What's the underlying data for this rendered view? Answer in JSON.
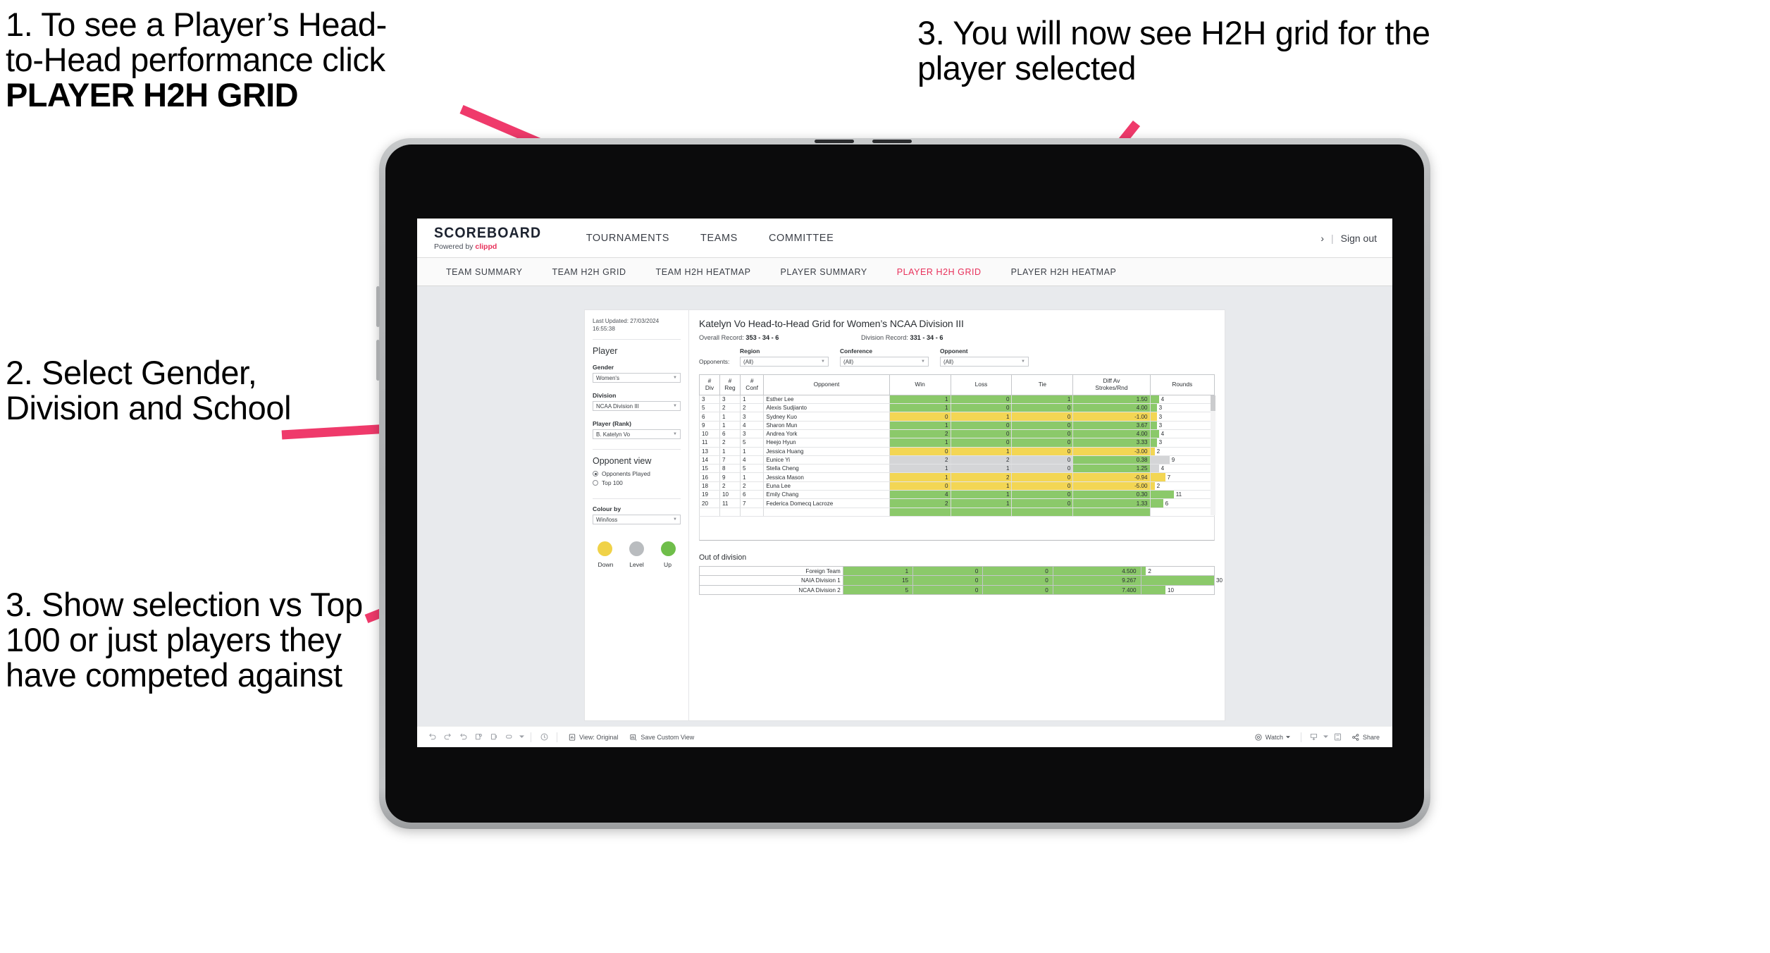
{
  "annotations": {
    "a1_line1": "1. To see a Player’s Head-",
    "a1_line2": "to-Head performance click",
    "a1_bold": "PLAYER H2H GRID",
    "a2": "2. Select Gender, Division and School",
    "a3": "3. Show selection vs Top 100 or just players they have competed against",
    "a4": "3. You will now see H2H grid for the player selected",
    "arrow_color": "#ef3a6b"
  },
  "app": {
    "logo_word": "SCOREBOARD",
    "logo_powered": "Powered by",
    "logo_brand": "clippd",
    "topnav": [
      "TOURNAMENTS",
      "TEAMS",
      "COMMITTEE"
    ],
    "header_right_chevron": "›",
    "header_right_sep": "|",
    "sign_out": "Sign out",
    "accent": "#e8305a"
  },
  "tabs": [
    {
      "label": "TEAM SUMMARY",
      "active": false
    },
    {
      "label": "TEAM H2H GRID",
      "active": false
    },
    {
      "label": "TEAM H2H HEATMAP",
      "active": false
    },
    {
      "label": "PLAYER SUMMARY",
      "active": false
    },
    {
      "label": "PLAYER H2H GRID",
      "active": true
    },
    {
      "label": "PLAYER H2H HEATMAP",
      "active": false
    }
  ],
  "sidebar": {
    "last_updated": "Last Updated: 27/03/2024 16:55:38",
    "player_heading": "Player",
    "fields": [
      {
        "label": "Gender",
        "value": "Women's"
      },
      {
        "label": "Division",
        "value": "NCAA Division III"
      },
      {
        "label": "Player (Rank)",
        "value": "B. Katelyn Vo"
      }
    ],
    "opponent_view_heading": "Opponent view",
    "radios": [
      {
        "label": "Opponents Played",
        "selected": true
      },
      {
        "label": "Top 100",
        "selected": false
      }
    ],
    "colour_by_label": "Colour by",
    "colour_by_value": "Win/loss",
    "legend": [
      {
        "label": "Down",
        "color": "#f0d248"
      },
      {
        "label": "Level",
        "color": "#b9bcbf"
      },
      {
        "label": "Up",
        "color": "#6fbe4a"
      }
    ]
  },
  "main": {
    "title": "Katelyn Vo Head-to-Head Grid for Women’s NCAA Division III",
    "overall_record_label": "Overall Record:",
    "overall_record_value": "353 - 34 - 6",
    "division_record_label": "Division Record:",
    "division_record_value": "331 - 34 - 6",
    "opponents_label": "Opponents:",
    "filters": [
      {
        "label": "Region",
        "value": "(All)"
      },
      {
        "label": "Conference",
        "value": "(All)"
      },
      {
        "label": "Opponent",
        "value": "(All)"
      }
    ]
  },
  "chart_data": {
    "type": "table",
    "title": "Katelyn Vo Head-to-Head Grid for Women’s NCAA Division III",
    "columns": [
      "# Div",
      "# Reg",
      "# Conf",
      "Opponent",
      "Win",
      "Loss",
      "Tie",
      "Diff Av Strokes/Rnd",
      "Rounds"
    ],
    "header_lines": [
      [
        "#",
        "Div"
      ],
      [
        "#",
        "Reg"
      ],
      [
        "#",
        "Conf"
      ],
      [
        "Opponent",
        ""
      ],
      [
        "Win",
        ""
      ],
      [
        "Loss",
        ""
      ],
      [
        "Tie",
        ""
      ],
      [
        "Diff Av",
        "Strokes/Rnd"
      ],
      [
        "Rounds",
        ""
      ]
    ],
    "rounds_max": 30,
    "rows": [
      {
        "div": "3",
        "reg": "3",
        "conf": "1",
        "opponent": "Esther Lee",
        "win": "1",
        "loss": "0",
        "tie": "1",
        "diff": "1.50",
        "rounds": 4,
        "color": "up"
      },
      {
        "div": "5",
        "reg": "2",
        "conf": "2",
        "opponent": "Alexis Sudjianto",
        "win": "1",
        "loss": "0",
        "tie": "0",
        "diff": "4.00",
        "rounds": 3,
        "color": "up"
      },
      {
        "div": "6",
        "reg": "1",
        "conf": "3",
        "opponent": "Sydney Kuo",
        "win": "0",
        "loss": "1",
        "tie": "0",
        "diff": "-1.00",
        "rounds": 3,
        "color": "down"
      },
      {
        "div": "9",
        "reg": "1",
        "conf": "4",
        "opponent": "Sharon Mun",
        "win": "1",
        "loss": "0",
        "tie": "0",
        "diff": "3.67",
        "rounds": 3,
        "color": "up"
      },
      {
        "div": "10",
        "reg": "6",
        "conf": "3",
        "opponent": "Andrea York",
        "win": "2",
        "loss": "0",
        "tie": "0",
        "diff": "4.00",
        "rounds": 4,
        "color": "up"
      },
      {
        "div": "11",
        "reg": "2",
        "conf": "5",
        "opponent": "Heejo Hyun",
        "win": "1",
        "loss": "0",
        "tie": "0",
        "diff": "3.33",
        "rounds": 3,
        "color": "up"
      },
      {
        "div": "13",
        "reg": "1",
        "conf": "1",
        "opponent": "Jessica Huang",
        "win": "0",
        "loss": "1",
        "tie": "0",
        "diff": "-3.00",
        "rounds": 2,
        "color": "down"
      },
      {
        "div": "14",
        "reg": "7",
        "conf": "4",
        "opponent": "Eunice Yi",
        "win": "2",
        "loss": "2",
        "tie": "0",
        "diff": "0.38",
        "rounds": 9,
        "color": "level",
        "diff_color": "up"
      },
      {
        "div": "15",
        "reg": "8",
        "conf": "5",
        "opponent": "Stella Cheng",
        "win": "1",
        "loss": "1",
        "tie": "0",
        "diff": "1.25",
        "rounds": 4,
        "color": "level",
        "diff_color": "up"
      },
      {
        "div": "16",
        "reg": "9",
        "conf": "1",
        "opponent": "Jessica Mason",
        "win": "1",
        "loss": "2",
        "tie": "0",
        "diff": "-0.94",
        "rounds": 7,
        "color": "down"
      },
      {
        "div": "18",
        "reg": "2",
        "conf": "2",
        "opponent": "Euna Lee",
        "win": "0",
        "loss": "1",
        "tie": "0",
        "diff": "-5.00",
        "rounds": 2,
        "color": "down"
      },
      {
        "div": "19",
        "reg": "10",
        "conf": "6",
        "opponent": "Emily Chang",
        "win": "4",
        "loss": "1",
        "tie": "0",
        "diff": "0.30",
        "rounds": 11,
        "color": "up"
      },
      {
        "div": "20",
        "reg": "11",
        "conf": "7",
        "opponent": "Federica Domecq Lacroze",
        "win": "2",
        "loss": "1",
        "tie": "0",
        "diff": "1.33",
        "rounds": 6,
        "color": "up"
      }
    ],
    "out_of_division_title": "Out of division",
    "out_of_division": [
      {
        "name": "Foreign Team",
        "win": "1",
        "loss": "0",
        "tie": "0",
        "diff": "4.500",
        "rounds": 2,
        "color": "up"
      },
      {
        "name": "NAIA Division 1",
        "win": "15",
        "loss": "0",
        "tie": "0",
        "diff": "9.267",
        "rounds": 30,
        "color": "up"
      },
      {
        "name": "NCAA Division 2",
        "win": "5",
        "loss": "0",
        "tie": "0",
        "diff": "7.400",
        "rounds": 10,
        "color": "up"
      }
    ]
  },
  "toolbar": {
    "view_label": "View: Original",
    "save_label": "Save Custom View",
    "watch_label": "Watch",
    "share_label": "Share"
  }
}
